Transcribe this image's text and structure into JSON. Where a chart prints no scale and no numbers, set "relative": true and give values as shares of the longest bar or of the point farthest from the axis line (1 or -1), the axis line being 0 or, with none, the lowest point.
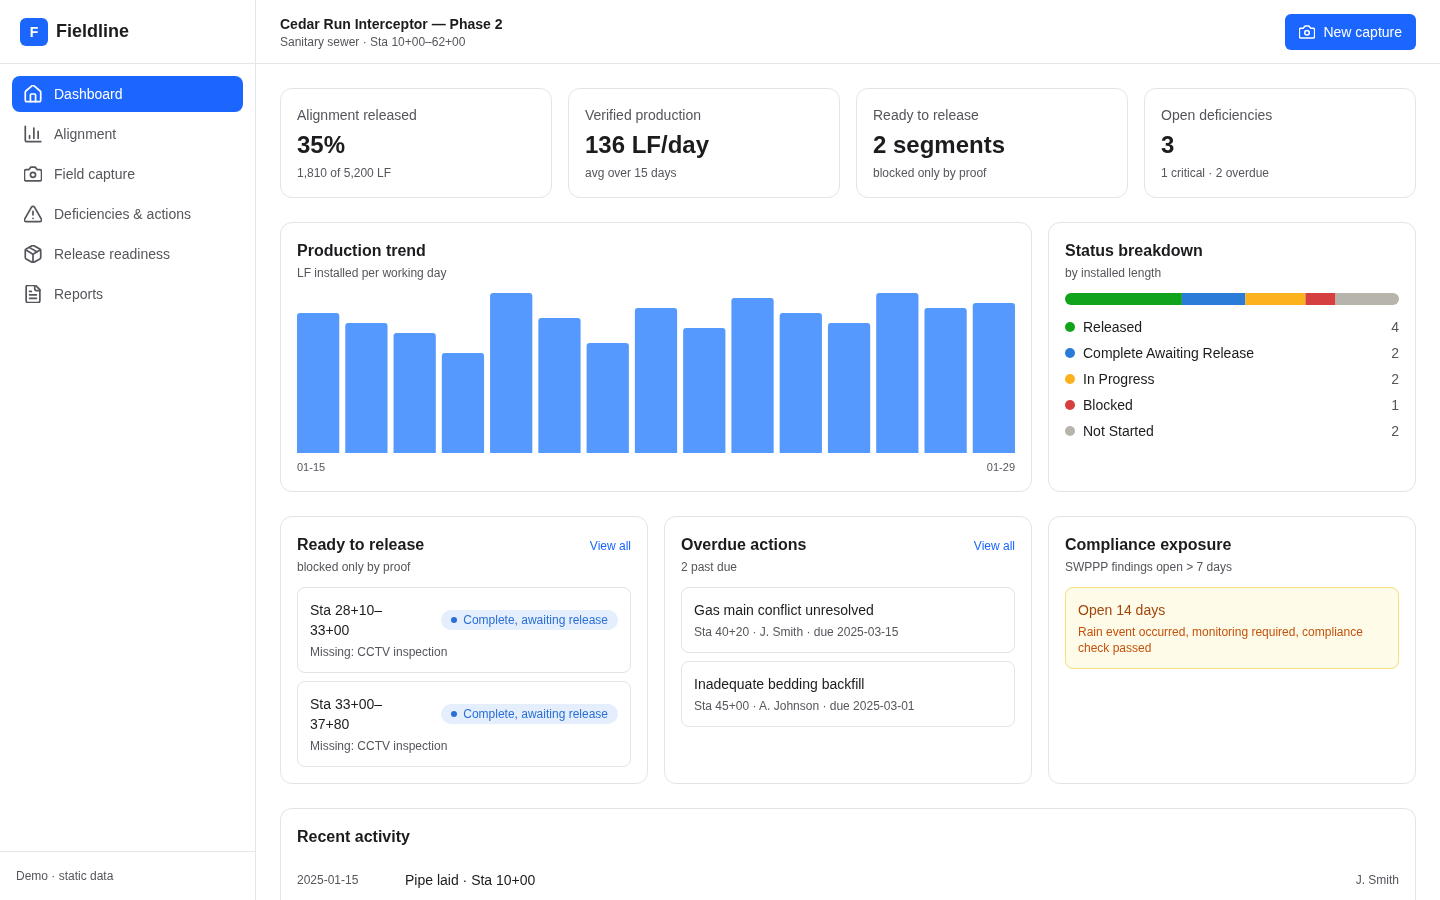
{
  "sidebar": {
    "brand": {
      "mark": "F",
      "name": "Fieldline"
    },
    "items": [
      {
        "label": "Dashboard",
        "selected": true
      },
      {
        "label": "Alignment",
        "selected": false
      },
      {
        "label": "Field capture",
        "selected": false
      },
      {
        "label": "Deficiencies & actions",
        "selected": false
      },
      {
        "label": "Release readiness",
        "selected": false
      },
      {
        "label": "Reports",
        "selected": false
      }
    ],
    "footer": "Demo · static data"
  },
  "header": {
    "title": "Cedar Run Interceptor — Phase 2",
    "subtitle": "Sanitary sewer · Sta 10+00–62+00",
    "action": "New capture"
  },
  "kpis": [
    {
      "label": "Alignment released",
      "value": "35%",
      "note": "1,810 of 5,200 LF"
    },
    {
      "label": "Verified production",
      "value": "136 LF/day",
      "note": "avg over 15 days"
    },
    {
      "label": "Ready to release",
      "value": "2 segments",
      "note": "blocked only by proof"
    },
    {
      "label": "Open deficiencies",
      "value": "3",
      "note": "1 critical · 2 overdue"
    }
  ],
  "production_trend": {
    "title": "Production trend",
    "subtitle": "LF installed per working day",
    "chart_data": {
      "type": "bar",
      "relative": true,
      "categories": [
        "01-15",
        null,
        null,
        null,
        null,
        null,
        null,
        null,
        null,
        null,
        null,
        null,
        null,
        null,
        "01-29"
      ],
      "values": [
        0.875,
        0.812,
        0.75,
        0.625,
        1.0,
        0.844,
        0.688,
        0.906,
        0.781,
        0.969,
        0.875,
        0.812,
        1.0,
        0.906,
        0.938
      ]
    }
  },
  "status_breakdown": {
    "title": "Status breakdown",
    "subtitle": "by installed length",
    "chart_data": {
      "type": "bar",
      "orientation": "horizontal",
      "stacked": true,
      "relative": true,
      "legend": "bottom",
      "series": [
        {
          "name": "Released",
          "color": "#12a31c",
          "values": [
            0.35
          ]
        },
        {
          "name": "Complete Awaiting Release",
          "color": "#2b7bd9",
          "values": [
            0.19
          ]
        },
        {
          "name": "In Progress",
          "color": "#fbb21d",
          "values": [
            0.18
          ]
        },
        {
          "name": "Blocked",
          "color": "#d53f3f",
          "values": [
            0.09
          ]
        },
        {
          "name": "Not Started",
          "color": "#b7b4ab",
          "values": [
            0.19
          ]
        }
      ]
    },
    "counts": [
      "4",
      "2",
      "2",
      "1",
      "2"
    ]
  },
  "ready_to_release": {
    "title": "Ready to release",
    "link": "View all",
    "subtitle": "blocked only by proof",
    "items": [
      {
        "station": "Sta 28+10–33+00",
        "status": "Complete, awaiting release",
        "missing": "Missing: CCTV inspection"
      },
      {
        "station": "Sta 33+00–37+80",
        "status": "Complete, awaiting release",
        "missing": "Missing: CCTV inspection"
      }
    ]
  },
  "overdue_actions": {
    "title": "Overdue actions",
    "link": "View all",
    "subtitle": "2 past due",
    "items": [
      {
        "title": "Gas main conflict unresolved",
        "meta": "Sta 40+20 · J. Smith · due 2025-03-15"
      },
      {
        "title": "Inadequate bedding backfill",
        "meta": "Sta 45+00 · A. Johnson · due 2025-03-01"
      }
    ]
  },
  "compliance_exposure": {
    "title": "Compliance exposure",
    "subtitle": "SWPPP findings open > 7 days",
    "alert": {
      "title": "Open 14 days",
      "text": "Rain event occurred, monitoring required, compliance check passed"
    }
  },
  "recent_activity": {
    "title": "Recent activity",
    "rows": [
      {
        "date": "2025-01-15",
        "event": "Pipe laid · Sta 10+00",
        "user": "J. Smith"
      }
    ]
  }
}
